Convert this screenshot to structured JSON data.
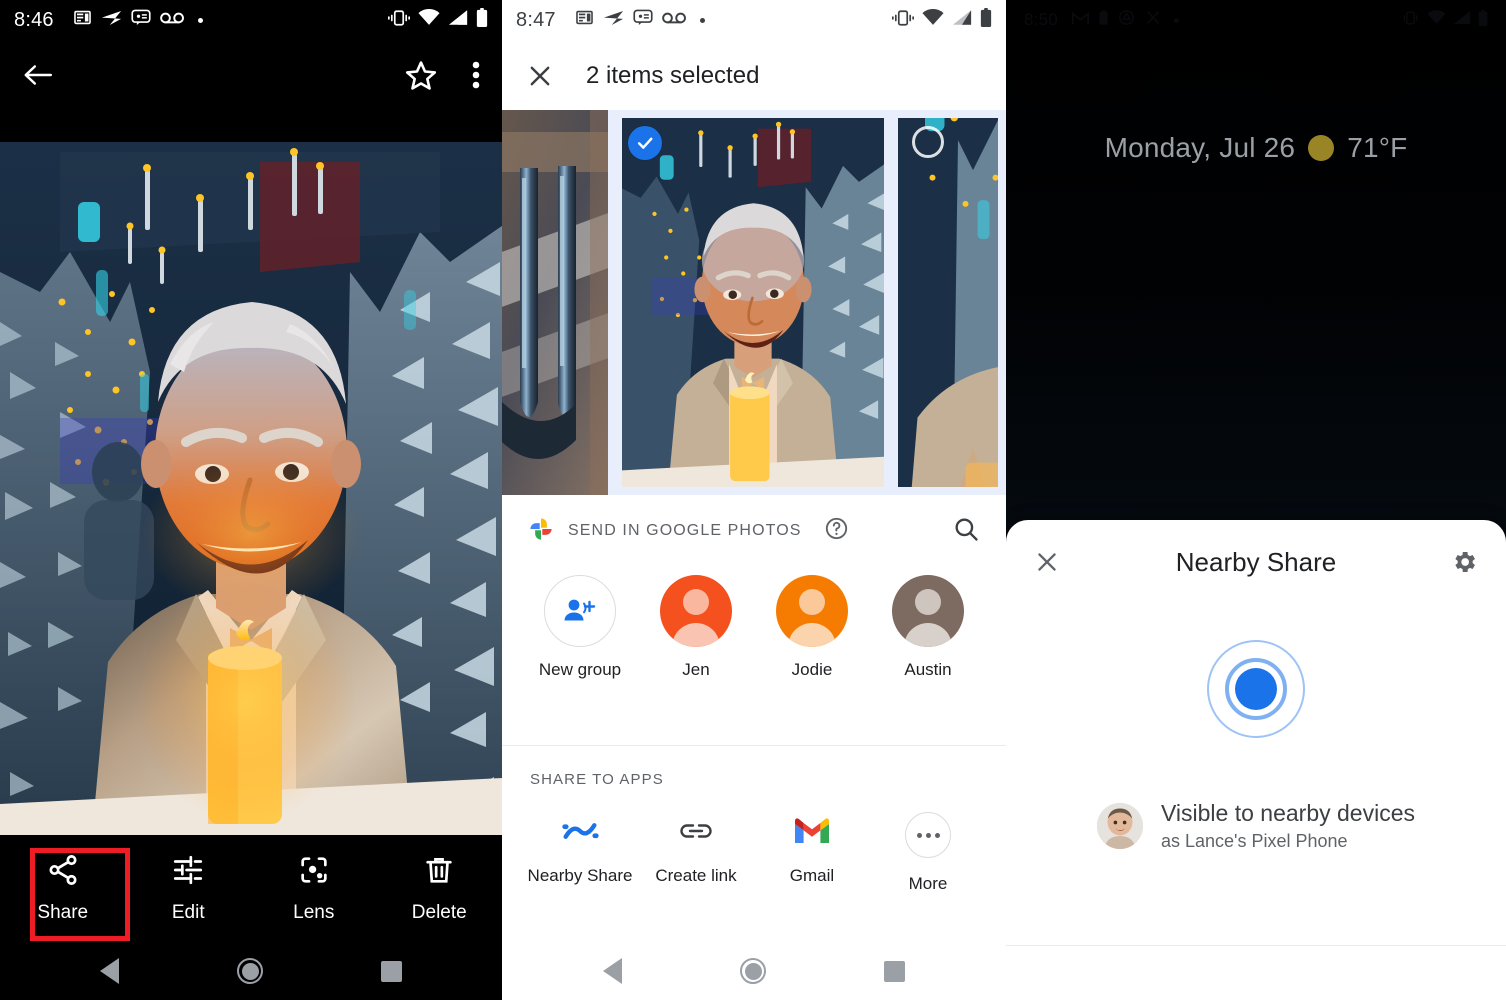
{
  "panel1": {
    "name": "google-photos-viewer",
    "status_bar": {
      "time": "8:46",
      "icons": [
        "news-icon",
        "send-icon",
        "chat-icon",
        "voicemail-icon",
        "dot-icon"
      ],
      "right_icons": [
        "vibrate-icon",
        "wifi-icon",
        "signal-icon",
        "battery-icon"
      ]
    },
    "appbar": {
      "back_icon": "arrow-back-icon",
      "favorite_icon": "star-outline-icon",
      "overflow_icon": "more-vert-icon"
    },
    "photo_alt": "Smiling man in tan jacket behind a lit candle with snowy trees and string lights",
    "actions": [
      {
        "label": "Share",
        "icon": "share-icon",
        "highlighted": true
      },
      {
        "label": "Edit",
        "icon": "tune-icon",
        "highlighted": false
      },
      {
        "label": "Lens",
        "icon": "lens-icon",
        "highlighted": false
      },
      {
        "label": "Delete",
        "icon": "trash-icon",
        "highlighted": false
      }
    ],
    "nav": {
      "back": "nav-back-icon",
      "home": "nav-home-icon",
      "recents": "nav-recents-icon"
    }
  },
  "panel2": {
    "name": "android-share-sheet",
    "status_bar": {
      "time": "8:47",
      "icons": [
        "news-icon",
        "send-icon",
        "chat-icon",
        "voicemail-icon",
        "dot-icon"
      ],
      "right_icons": [
        "vibrate-icon",
        "wifi-icon",
        "signal-icon",
        "battery-icon"
      ]
    },
    "appbar": {
      "close_icon": "close-icon",
      "title": "2 items selected"
    },
    "thumbnails": [
      {
        "alt": "Close-up of silver forks on a table",
        "selected": false,
        "partial": true
      },
      {
        "alt": "Man with candle portrait",
        "selected": true,
        "partial": false
      },
      {
        "alt": "Man with candle portrait repeated",
        "selected": false,
        "partial": true
      }
    ],
    "send_section": {
      "label": "SEND IN GOOGLE PHOTOS",
      "photos_icon": "google-photos-icon",
      "help_icon": "help-circle-icon",
      "search_icon": "search-icon"
    },
    "contacts": [
      {
        "name": "New group",
        "type": "new-group",
        "color": "#1a73e8"
      },
      {
        "name": "Jen",
        "type": "avatar",
        "color": "#f4511e"
      },
      {
        "name": "Jodie",
        "type": "avatar",
        "color": "#f57c00"
      },
      {
        "name": "Austin",
        "type": "avatar",
        "color": "#7d6a61"
      }
    ],
    "apps_section": {
      "label": "SHARE TO APPS",
      "apps": [
        {
          "name": "Nearby Share",
          "icon": "nearby-share-icon",
          "highlighted": true
        },
        {
          "name": "Create link",
          "icon": "link-icon",
          "highlighted": false
        },
        {
          "name": "Gmail",
          "icon": "gmail-icon",
          "highlighted": false
        },
        {
          "name": "More",
          "icon": "more-horiz-icon",
          "highlighted": false
        }
      ]
    },
    "nav": {
      "back": "nav-back-icon",
      "home": "nav-home-icon",
      "recents": "nav-recents-icon"
    }
  },
  "panel3": {
    "name": "nearby-share-sheet",
    "status_bar": {
      "time": "8:50"
    },
    "lockscreen": {
      "datetime": "Monday, Jul 26",
      "temperature": "71°F",
      "weather_icon": "sun-icon",
      "weather_color": "#9a8526"
    },
    "sheet": {
      "close_icon": "close-icon",
      "title": "Nearby Share",
      "settings_icon": "gear-icon",
      "radar_icon": "scanning-radar-icon",
      "accent_color": "#1a73e8",
      "visibility_title": "Visible to nearby devices",
      "visibility_subtitle": "as Lance's Pixel Phone",
      "avatar": "user-avatar"
    }
  }
}
